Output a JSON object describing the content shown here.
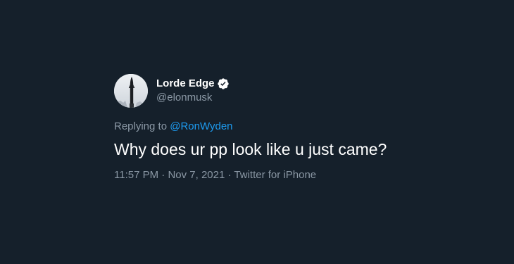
{
  "tweet": {
    "author": {
      "display_name": "Lorde Edge",
      "handle": "@elonmusk",
      "verified": true,
      "avatar_icon": "starship-photo"
    },
    "reply_prefix": "Replying to",
    "reply_to": "@RonWyden",
    "text": "Why does ur pp look like u just came?",
    "time": "11:57 PM",
    "date": "Nov 7, 2021",
    "source": "Twitter for iPhone",
    "separator": "·"
  },
  "colors": {
    "background": "#15202b",
    "primary_text": "#ffffff",
    "secondary_text": "#8b98a5",
    "link": "#1d9bf0"
  }
}
